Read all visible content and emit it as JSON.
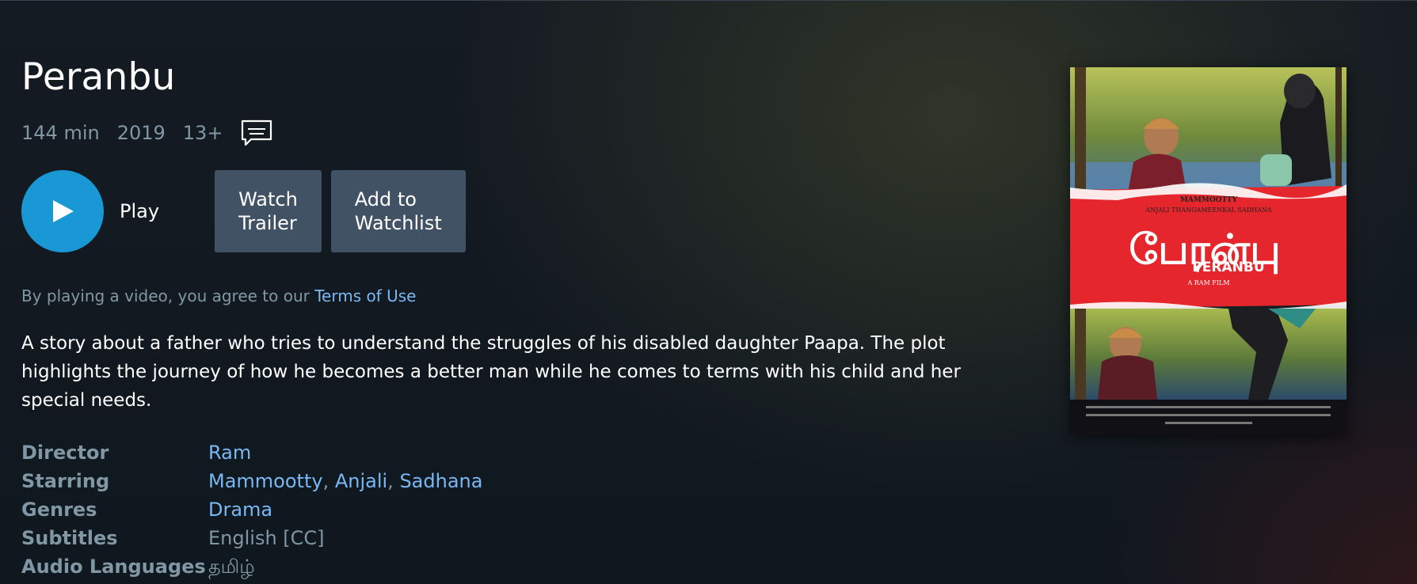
{
  "title": "Peranbu",
  "meta": {
    "runtime": "144 min",
    "year": "2019",
    "rating": "13+"
  },
  "actions": {
    "play_label": "Play",
    "trailer_line1": "Watch",
    "trailer_line2": "Trailer",
    "watchlist_line1": "Add to",
    "watchlist_line2": "Watchlist"
  },
  "terms": {
    "prefix": "By playing a video, you agree to our ",
    "link": "Terms of Use"
  },
  "synopsis": "A story about a father who tries to understand the struggles of his disabled daughter Paapa. The plot highlights the journey of how he becomes a better man while he comes to terms with his child and her special needs.",
  "details": {
    "director_label": "Director",
    "director": "Ram",
    "starring_label": "Starring",
    "starring": [
      "Mammootty",
      "Anjali",
      "Sadhana"
    ],
    "genres_label": "Genres",
    "genres": "Drama",
    "subtitles_label": "Subtitles",
    "subtitles": "English [CC]",
    "audio_label": "Audio Languages",
    "audio": "தமிழ்"
  },
  "icons": {
    "play": "play-icon",
    "subtitles": "subtitles-cc-icon"
  },
  "poster": {
    "credit_top": "MAMMOOTTY",
    "credit_names": "ANJALI  THANGAMEENKAL SADHANA",
    "tamil_title": "பேரன்பு",
    "latin_title": "PERANBU",
    "director_credit": "A RAM FILM"
  },
  "colors": {
    "accent": "#1a98d5",
    "link": "#79b8f3",
    "muted": "#8197a4",
    "button": "#425265",
    "poster_band": "#e5272d"
  }
}
